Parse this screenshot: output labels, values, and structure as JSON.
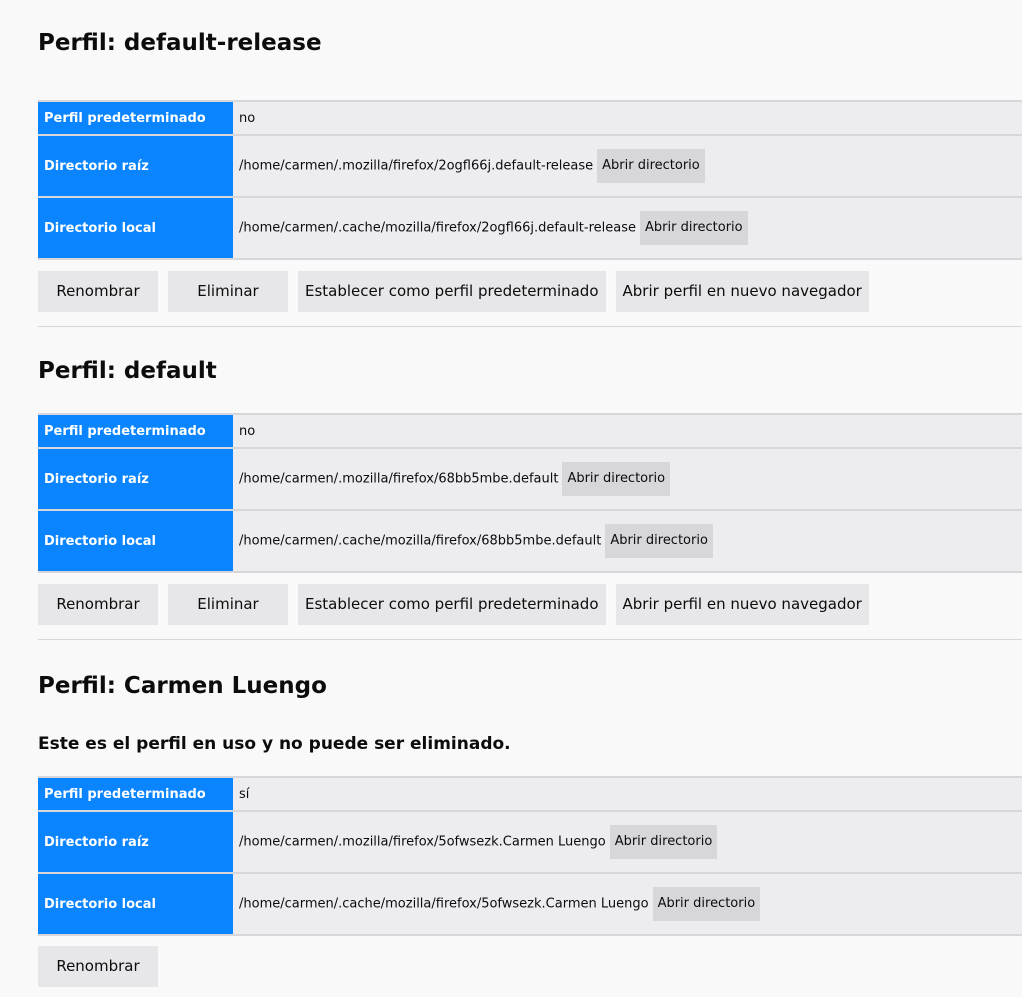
{
  "labels": {
    "default_profile": "Perfil predeterminado",
    "root_dir": "Directorio raíz",
    "local_dir": "Directorio local",
    "open_dir": "Abrir directorio",
    "rename": "Renombrar",
    "remove": "Eliminar",
    "set_default": "Establecer como perfil predeterminado",
    "launch": "Abrir perfil en nuevo navegador"
  },
  "profiles": [
    {
      "title": "Perfil: default-release",
      "is_default": "no",
      "root_dir": "/home/carmen/.mozilla/firefox/2ogfl66j.default-release",
      "local_dir": "/home/carmen/.cache/mozilla/firefox/2ogfl66j.default-release"
    },
    {
      "title": "Perfil: default",
      "is_default": "no",
      "root_dir": "/home/carmen/.mozilla/firefox/68bb5mbe.default",
      "local_dir": "/home/carmen/.cache/mozilla/firefox/68bb5mbe.default"
    },
    {
      "title": "Perfil: Carmen Luengo",
      "in_use_note": "Este es el perfil en uso y no puede ser eliminado.",
      "is_default": "sí",
      "root_dir": "/home/carmen/.mozilla/firefox/5ofwsezk.Carmen Luengo",
      "local_dir": "/home/carmen/.cache/mozilla/firefox/5ofwsezk.Carmen Luengo"
    }
  ],
  "colors": {
    "header_cell": "#0a84ff",
    "value_cell": "#ededf0",
    "button": "#e7e7e9",
    "page_bg": "#f9f9fa"
  }
}
